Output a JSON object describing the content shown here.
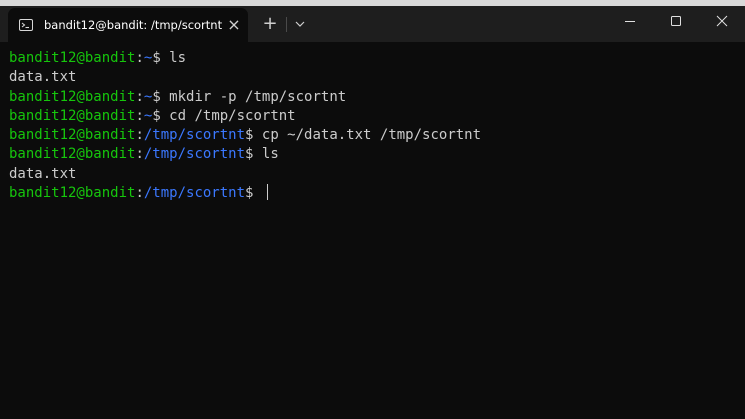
{
  "window": {
    "tab_title": "bandit12@bandit: /tmp/scortnt",
    "tab_close_glyph": "×",
    "new_tab_glyph": "+",
    "icons": {
      "tab": "terminal-icon",
      "close_tab": "close-icon",
      "new_tab": "plus-icon",
      "dropdown": "chevron-down-icon",
      "minimize": "minimize-icon",
      "maximize": "maximize-icon",
      "close_window": "close-icon"
    }
  },
  "colors": {
    "background": "#0c0c0c",
    "titlebar": "#1e1e1e",
    "user_host": "#16c60c",
    "path": "#3b78ff",
    "text": "#cccccc"
  },
  "terminal": {
    "lines": [
      {
        "type": "prompt",
        "user": "bandit12@bandit",
        "sep": ":",
        "path": "~",
        "symbol": "$ ",
        "command": "ls"
      },
      {
        "type": "output",
        "text": "data.txt"
      },
      {
        "type": "prompt",
        "user": "bandit12@bandit",
        "sep": ":",
        "path": "~",
        "symbol": "$ ",
        "command": "mkdir -p /tmp/scortnt"
      },
      {
        "type": "prompt",
        "user": "bandit12@bandit",
        "sep": ":",
        "path": "~",
        "symbol": "$ ",
        "command": "cd /tmp/scortnt"
      },
      {
        "type": "prompt",
        "user": "bandit12@bandit",
        "sep": ":",
        "path": "/tmp/scortnt",
        "symbol": "$ ",
        "command": "cp ~/data.txt /tmp/scortnt"
      },
      {
        "type": "prompt",
        "user": "bandit12@bandit",
        "sep": ":",
        "path": "/tmp/scortnt",
        "symbol": "$ ",
        "command": "ls"
      },
      {
        "type": "output",
        "text": "data.txt"
      },
      {
        "type": "prompt",
        "user": "bandit12@bandit",
        "sep": ":",
        "path": "/tmp/scortnt",
        "symbol": "$ ",
        "command": ""
      }
    ]
  }
}
